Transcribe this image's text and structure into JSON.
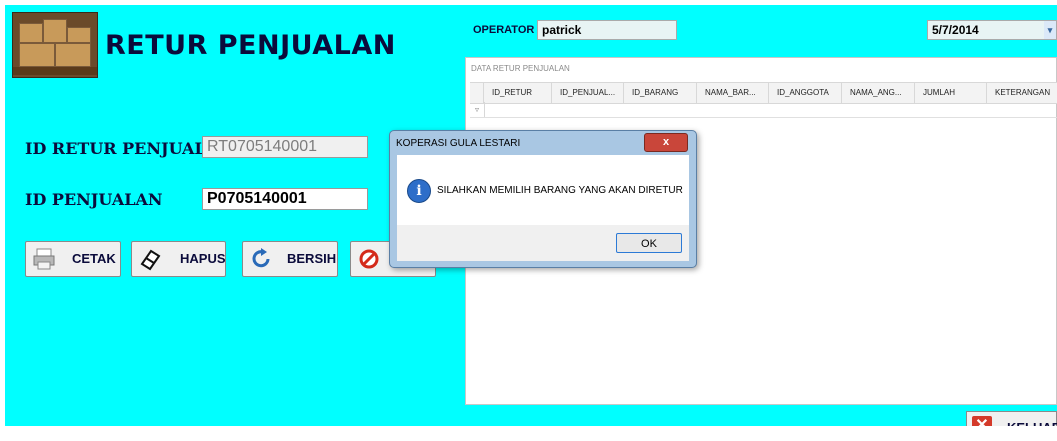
{
  "form": {
    "title": "RETUR PENJUALAN",
    "id_retur_label": "ID RETUR PENJUALAN",
    "id_retur_value": "RT0705140001",
    "id_penjualan_label": "ID PENJUALAN",
    "id_penjualan_value": "P0705140001"
  },
  "buttons": {
    "cetak": "CETAK",
    "hapus": "HAPUS",
    "bersih": "BERSIH",
    "keluar": "KELUAR"
  },
  "header": {
    "operator_label": "OPERATOR",
    "operator_value": "patrick",
    "date_value": "5/7/2014"
  },
  "grid": {
    "caption": "DATA RETUR PENJUALAN",
    "columns": [
      "ID_RETUR",
      "ID_PENJUAL...",
      "ID_BARANG",
      "NAMA_BAR...",
      "ID_ANGGOTA",
      "NAMA_ANG...",
      "JUMLAH",
      "KETERANGAN"
    ],
    "new_row_marker": "▿"
  },
  "dialog": {
    "title": "KOPERASI GULA LESTARI",
    "message": "SILAHKAN MEMILIH BARANG YANG AKAN DIRETUR",
    "ok_label": "OK",
    "close_glyph": "x",
    "info_glyph": "i"
  },
  "colors": {
    "panel": "#00ffff",
    "text_dark": "#0b0b3b"
  },
  "icons": {
    "cetak": "printer-icon",
    "hapus": "eraser-icon",
    "bersih": "refresh-icon",
    "hidden": "cancel-icon",
    "keluar": "close-icon",
    "logo": "packages-icon",
    "info": "info-icon"
  }
}
